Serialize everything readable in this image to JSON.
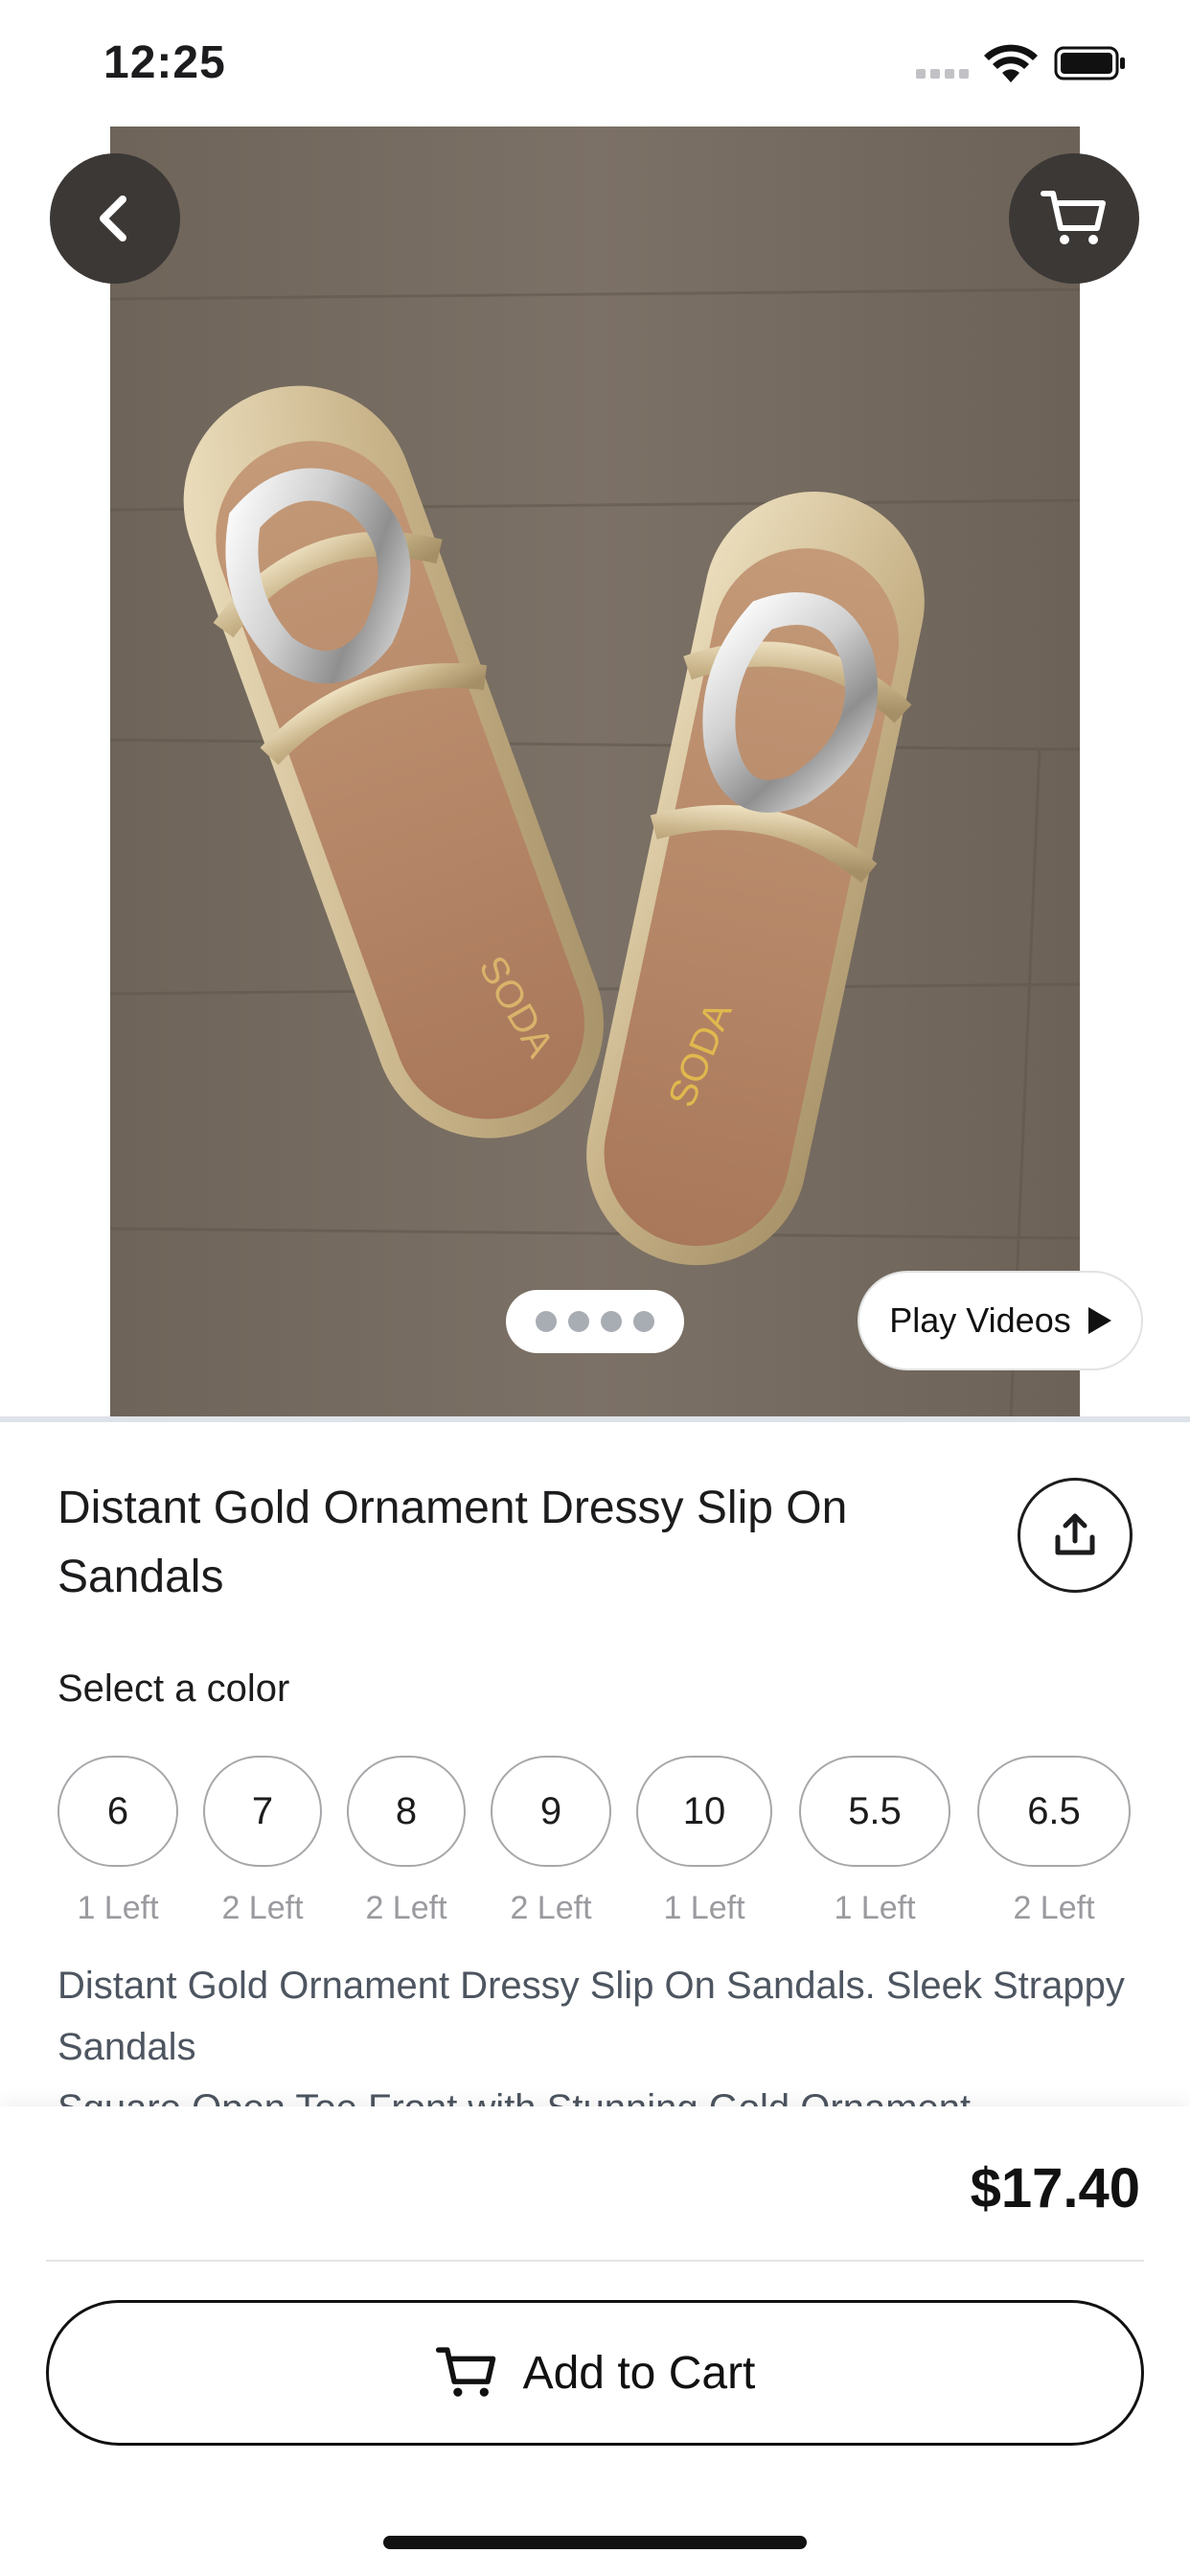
{
  "status_bar": {
    "time": "12:25"
  },
  "hero": {
    "image_alt": "Gold slip-on sandals with silver ornament on wooden floor",
    "pager_count": 4,
    "play_videos_label": "Play Videos"
  },
  "product": {
    "title": "Distant Gold Ornament Dressy Slip On Sandals",
    "select_label": "Select a color",
    "sizes": [
      {
        "size": "6",
        "stock": "1 Left"
      },
      {
        "size": "7",
        "stock": "2 Left"
      },
      {
        "size": "8",
        "stock": "2 Left"
      },
      {
        "size": "9",
        "stock": "2 Left"
      },
      {
        "size": "10",
        "stock": "1 Left"
      },
      {
        "size": "5.5",
        "stock": "1 Left"
      },
      {
        "size": "6.5",
        "stock": "2 Left"
      }
    ],
    "description": "Distant Gold Ornament Dressy Slip On Sandals. Sleek Strappy Sandals\nSquare Open Toe Front with Stunning Gold Ornament"
  },
  "checkout": {
    "price": "$17.40",
    "add_to_cart_label": "Add to Cart"
  },
  "colors": {
    "button_dark": "#3b3836",
    "text": "#1c1c1e",
    "muted": "#9a9a9f"
  }
}
